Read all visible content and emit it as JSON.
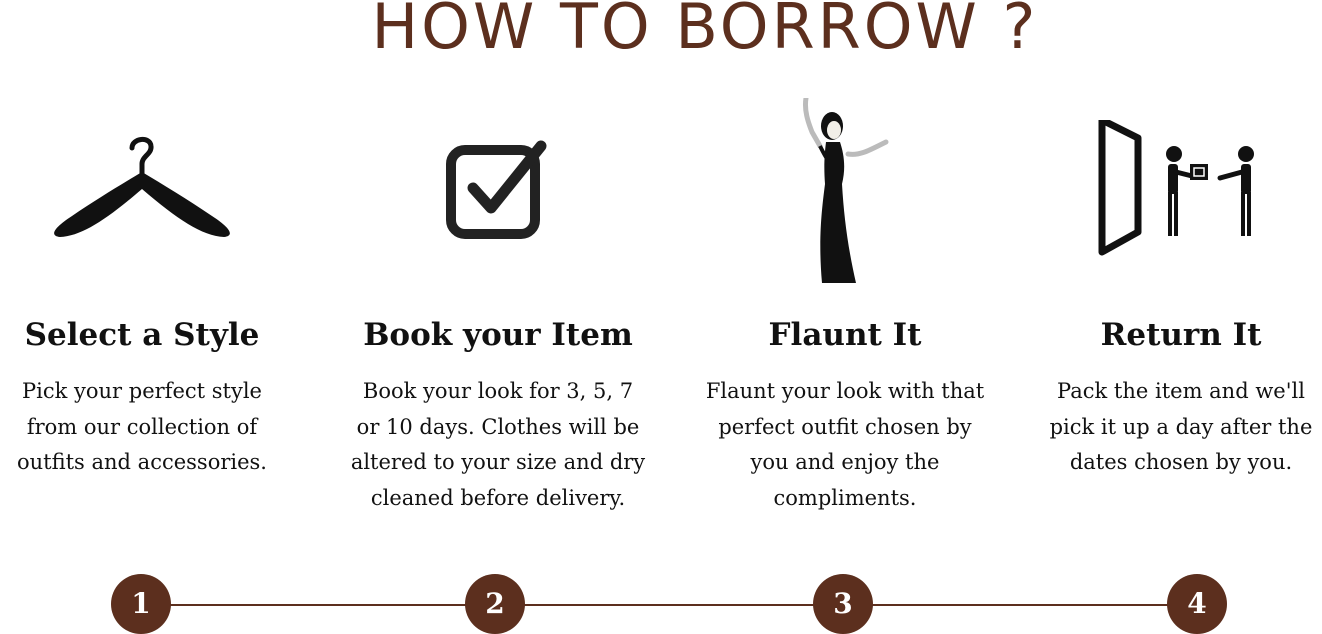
{
  "header": {
    "title": "HOW TO BORROW ?"
  },
  "steps": [
    {
      "icon": "hanger-icon",
      "title": "Select a Style",
      "description_lines": [
        "Pick your perfect style",
        "from our collection of",
        "outfits and accessories."
      ],
      "number": "1"
    },
    {
      "icon": "checkbox-icon",
      "title": "Book your Item",
      "description_lines": [
        "Book your look for  3, 5, 7",
        "or 10 days. Clothes will be",
        "altered to your size and dry",
        "cleaned before delivery."
      ],
      "number": "2"
    },
    {
      "icon": "woman-in-gown-icon",
      "title": "Flaunt It",
      "description_lines": [
        "Flaunt your look with that",
        "perfect outfit chosen by",
        "you and enjoy the",
        "compliments."
      ],
      "number": "3"
    },
    {
      "icon": "delivery-pickup-icon",
      "title": "Return It",
      "description_lines": [
        "Pack the item and we'll",
        "pick it up a day after the",
        "dates chosen by you."
      ],
      "number": "4"
    }
  ],
  "colors": {
    "accent": "#5c2f1e",
    "text": "#111111",
    "background": "#ffffff"
  }
}
